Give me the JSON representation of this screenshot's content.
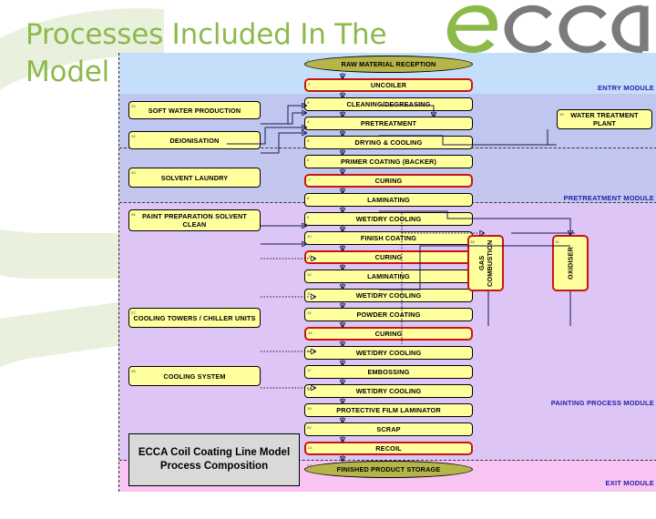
{
  "slide": {
    "title": "Processes Included In The Model",
    "logo_text": "ecca",
    "title_color": "#8cba4a",
    "logo_colors": {
      "accent": "#8cba4a",
      "grey": "#7b7b7b"
    }
  },
  "diagram": {
    "legend": {
      "line1": "ECCA Coil Coating Line Model",
      "line2": "Process Composition"
    },
    "module_labels": [
      {
        "name": "entry",
        "text": "ENTRY MODULE",
        "color": "#2222a8"
      },
      {
        "name": "pretreatment",
        "text": "PRETREATMENT MODULE",
        "color": "#2222a8"
      },
      {
        "name": "painting",
        "text": "PAINTING PROCESS MODULE",
        "color": "#2222a8"
      },
      {
        "name": "exit",
        "text": "EXIT MODULE",
        "color": "#2222a8"
      }
    ],
    "bands": [
      {
        "name": "entry-band",
        "color": "#c5def9"
      },
      {
        "name": "entry-band-lower",
        "color": "#bfc6f0"
      },
      {
        "name": "pretreatment-band",
        "color": "#c3c7ef"
      },
      {
        "name": "painting-band",
        "color": "#ddc6f5"
      },
      {
        "name": "exit-band",
        "color": "#f9c3f2"
      }
    ],
    "center_column": [
      {
        "id": "raw-material-reception",
        "label": "RAW MATERIAL RECEPTION",
        "shape": "terminator",
        "num": "1"
      },
      {
        "id": "uncoiler",
        "label": "UNCOILER",
        "shape": "process",
        "highlight": true,
        "num": "2"
      },
      {
        "id": "cleaning-degreasing",
        "label": "CLEANING/DEGREASING",
        "shape": "process",
        "highlight": false,
        "num": "3"
      },
      {
        "id": "pretreatment",
        "label": "PRETREATMENT",
        "shape": "process",
        "highlight": false,
        "num": "4"
      },
      {
        "id": "drying-cooling",
        "label": "DRYING & COOLING",
        "shape": "process",
        "highlight": false,
        "num": "5"
      },
      {
        "id": "primer-coating-backer",
        "label": "PRIMER COATING (BACKER)",
        "shape": "process",
        "highlight": false,
        "num": "6"
      },
      {
        "id": "curing-1",
        "label": "CURING",
        "shape": "process",
        "highlight": true,
        "num": "7"
      },
      {
        "id": "laminating-1",
        "label": "LAMINATING",
        "shape": "process",
        "highlight": false,
        "num": "8"
      },
      {
        "id": "wet-dry-cooling-1",
        "label": "WET/DRY COOLING",
        "shape": "process",
        "highlight": false,
        "num": "9"
      },
      {
        "id": "finish-coating",
        "label": "FINISH COATING",
        "shape": "process",
        "highlight": false,
        "num": "10"
      },
      {
        "id": "curing-2",
        "label": "CURING",
        "shape": "process",
        "highlight": true,
        "num": "11"
      },
      {
        "id": "laminating-2",
        "label": "LAMINATING",
        "shape": "process",
        "highlight": false,
        "num": "12"
      },
      {
        "id": "wet-dry-cooling-2",
        "label": "WET/DRY COOLING",
        "shape": "process",
        "highlight": false,
        "num": "13"
      },
      {
        "id": "powder-coating",
        "label": "POWDER COATING",
        "shape": "process",
        "highlight": false,
        "num": "14"
      },
      {
        "id": "curing-3",
        "label": "CURING",
        "shape": "process",
        "highlight": true,
        "num": "15"
      },
      {
        "id": "wet-dry-cooling-3",
        "label": "WET/DRY COOLING",
        "shape": "process",
        "highlight": false,
        "num": "16"
      },
      {
        "id": "embossing",
        "label": "EMBOSSING",
        "shape": "process",
        "highlight": false,
        "num": "17"
      },
      {
        "id": "wet-dry-cooling-4",
        "label": "WET/DRY COOLING",
        "shape": "process",
        "highlight": false,
        "num": "18"
      },
      {
        "id": "protective-film-laminator",
        "label": "PROTECTIVE FILM LAMINATOR",
        "shape": "process",
        "highlight": false,
        "num": "19"
      },
      {
        "id": "scrap",
        "label": "SCRAP",
        "shape": "process",
        "highlight": false,
        "num": "20"
      },
      {
        "id": "recoil",
        "label": "RECOIL",
        "shape": "process",
        "highlight": true,
        "num": "21"
      },
      {
        "id": "finished-product-storage",
        "label": "FINISHED PRODUCT STORAGE",
        "shape": "terminator",
        "num": "22"
      }
    ],
    "left_column": [
      {
        "id": "soft-water-production",
        "label": "SOFT WATER PRODUCTION",
        "num": "23"
      },
      {
        "id": "deionisation",
        "label": "DEIONISATION",
        "num": "24"
      },
      {
        "id": "solvent-laundry",
        "label": "SOLVENT LAUNDRY",
        "num": "25"
      },
      {
        "id": "paint-preparation-solvent-clean",
        "label": "PAINT PREPARATION SOLVENT CLEAN",
        "num": "26"
      },
      {
        "id": "cooling-towers-chiller-units",
        "label": "COOLING TOWERS / CHILLER UNITS",
        "num": "27"
      },
      {
        "id": "cooling-system",
        "label": "COOLING SYSTEM",
        "num": "28"
      }
    ],
    "right_column": [
      {
        "id": "water-treatment-plant",
        "label": "WATER TREATMENT PLANT",
        "num": "29",
        "orientation": "horizontal",
        "highlight": false
      },
      {
        "id": "gas-combustion",
        "label": "GAS COMBUSTION",
        "num": "30",
        "orientation": "vertical",
        "highlight": true
      },
      {
        "id": "oxidiser",
        "label": "OXIDISER",
        "num": "31",
        "orientation": "vertical",
        "highlight": true
      }
    ]
  }
}
